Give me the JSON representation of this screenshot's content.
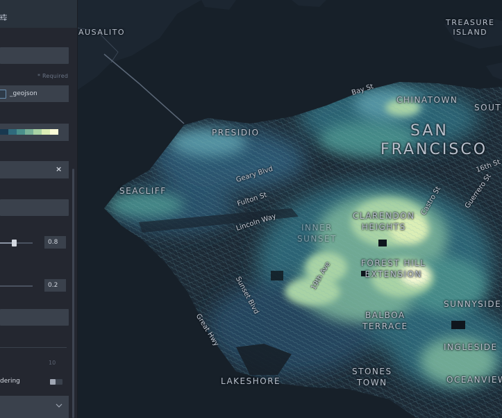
{
  "panel": {
    "required_label": "* Required",
    "geojson_label": "_geojson",
    "palette": [
      "#18384f",
      "#2f6a7c",
      "#4a8f8b",
      "#78b198",
      "#a9d3a5",
      "#dbeeb6",
      "#fbfdd8"
    ],
    "opacity_value": "0.8",
    "opacity_fraction": 0.8,
    "second_value": "0.2",
    "second_fraction": 0.2,
    "faint_value": "10",
    "ordering_label": "dering"
  },
  "map": {
    "labels": {
      "sausalito": "AUSALITO",
      "treasure_island_1": "TREASURE",
      "treasure_island_2": "ISLAND",
      "chinatown": "CHINATOWN",
      "south": "SOUTH",
      "presidio": "PRESIDIO",
      "san": "SAN",
      "francisco": "FRANCISCO",
      "seacliff": "SEACLIFF",
      "clarendon_1": "CLARENDON",
      "clarendon_2": "HEIGHTS",
      "inner_1": "INNER",
      "inner_2": "SUNSET",
      "forest_hill_1": "FOREST HILL",
      "forest_hill_2": "EXTENSION",
      "sunnyside": "SUNNYSIDE",
      "balboa_1": "BALBOA",
      "balboa_2": "TERRACE",
      "ingleside": "INGLESIDE",
      "lakeshore": "LAKESHORE",
      "stones_1": "STONES",
      "stones_2": "TOWN",
      "oceanview": "OCEANVIEW"
    },
    "streets": {
      "bay_st": "Bay St",
      "geary": "Geary Blvd",
      "fulton": "Fulton St",
      "lincoln": "Lincoln Way",
      "nineteenth": "19th Ave",
      "sunset": "Sunset Blvd",
      "great_hwy": "Great Hwy",
      "castro": "Castro St",
      "guerrero": "Guerrero St",
      "sixteenth": "16th St"
    },
    "colors": {
      "water": "#172029",
      "land": "#1d2833",
      "contour_low": "#2f5c78",
      "contour_mid": "#5a9aa8",
      "contour_high": "#e8f2c4"
    }
  }
}
